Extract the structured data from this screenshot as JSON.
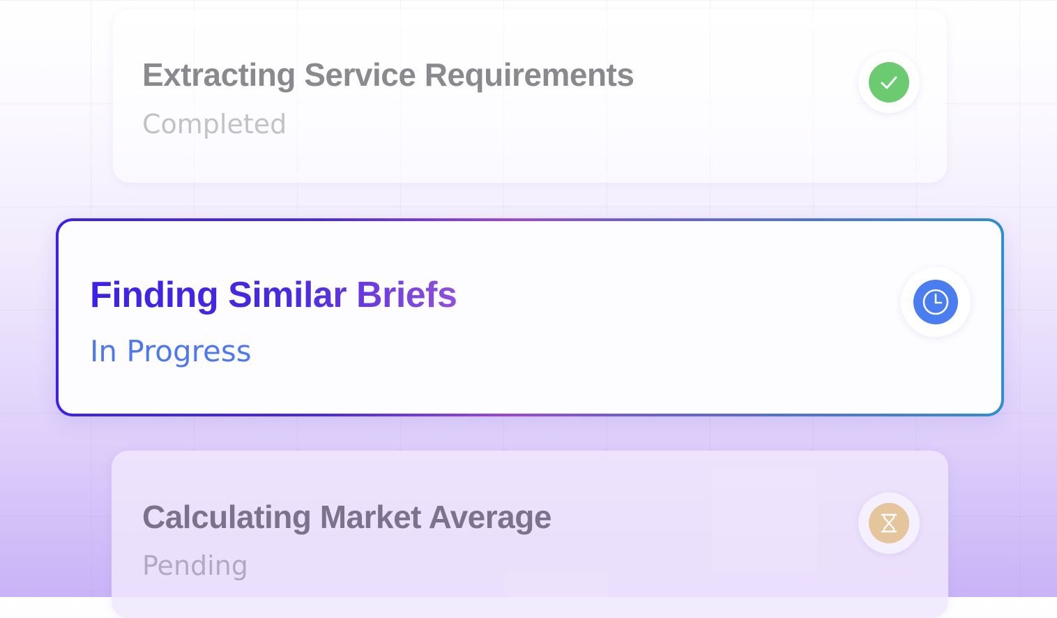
{
  "steps": [
    {
      "title": "Extracting Service Requirements",
      "status": "Completed",
      "icon": "check-icon",
      "color": "#6ccb70"
    },
    {
      "title": "Finding Similar Briefs",
      "status": "In Progress",
      "icon": "clock-icon",
      "color": "#4a7ef0"
    },
    {
      "title": "Calculating Market Average",
      "status": "Pending",
      "icon": "hourglass-icon",
      "color": "#e5c59b"
    }
  ],
  "colors": {
    "accent_start": "#3b22e6",
    "accent_mid": "#9b46d8",
    "accent_end": "#2f8ed0",
    "background_bottom": "#c9b3f7"
  }
}
